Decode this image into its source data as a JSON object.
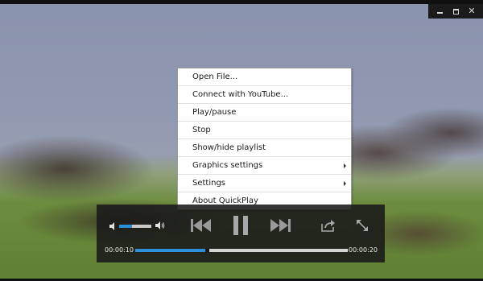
{
  "window": {
    "controls": {
      "minimize": "minimize-icon",
      "maximize": "maximize-icon",
      "close": "close-icon"
    }
  },
  "context_menu": {
    "items": [
      {
        "label": "Open File...",
        "submenu": false
      },
      {
        "label": "Connect with YouTube...",
        "submenu": false
      },
      {
        "label": "Play/pause",
        "submenu": false
      },
      {
        "label": "Stop",
        "submenu": false
      },
      {
        "label": "Show/hide playlist",
        "submenu": false
      },
      {
        "label": "Graphics settings",
        "submenu": true
      },
      {
        "label": "Settings",
        "submenu": true
      },
      {
        "label": "About QuickPlay",
        "submenu": false
      }
    ]
  },
  "player": {
    "elapsed": "00:00:10",
    "remaining": "-00:00:20",
    "progress": 0.33,
    "volume": 0.4,
    "accent_color": "#2c8fd6",
    "icons": [
      "volume-low-icon",
      "volume-high-icon",
      "previous-icon",
      "pause-icon",
      "next-icon",
      "share-icon",
      "fullscreen-icon"
    ]
  }
}
